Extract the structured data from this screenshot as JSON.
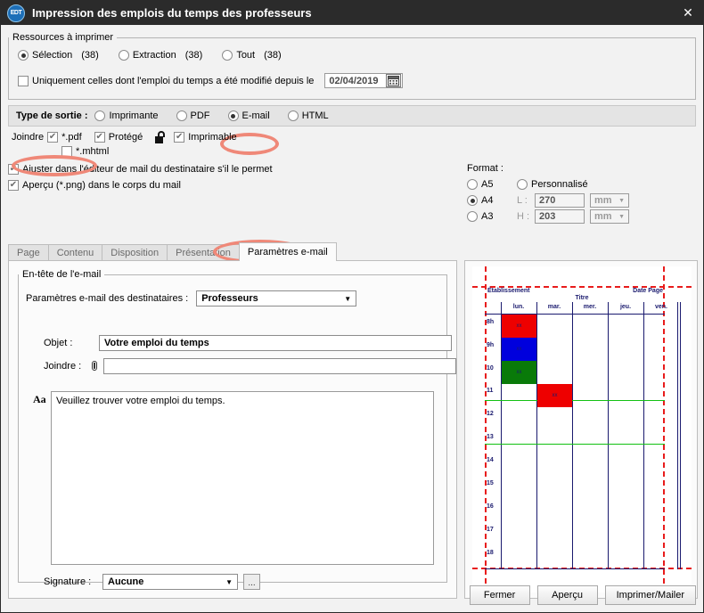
{
  "window": {
    "title": "Impression des emplois du temps des professeurs",
    "logo_text": "EDT",
    "close_icon": "close-icon"
  },
  "resources": {
    "legend": "Ressources à imprimer",
    "options": [
      {
        "label": "Sélection",
        "count": "(38)",
        "selected": true
      },
      {
        "label": "Extraction",
        "count": "(38)",
        "selected": false
      },
      {
        "label": "Tout",
        "count": "(38)",
        "selected": false
      }
    ],
    "modified_checkbox": {
      "label": "Uniquement celles dont l'emploi du temps a été modifié depuis le",
      "checked": false
    },
    "date_value": "02/04/2019",
    "calendar_icon": "calendar-icon"
  },
  "output": {
    "label": "Type de sortie :",
    "options": [
      {
        "label": "Imprimante",
        "selected": false
      },
      {
        "label": "PDF",
        "selected": false
      },
      {
        "label": "E-mail",
        "selected": true
      },
      {
        "label": "HTML",
        "selected": false
      }
    ]
  },
  "attach": {
    "joindre_label": "Joindre",
    "pdf": {
      "label": "*.pdf",
      "checked": true
    },
    "protege": {
      "label": "Protégé",
      "checked": true
    },
    "lock_icon": "unlocked-padlock-icon",
    "imprimable": {
      "label": "Imprimable",
      "checked": true
    },
    "mhtml": {
      "label": "*.mhtml",
      "checked": false
    },
    "ajuster": {
      "label": "Ajuster dans l'éditeur de mail du destinataire s'il le permet",
      "checked": true
    },
    "apercu": {
      "label": "Aperçu (*.png) dans le corps du mail",
      "checked": true
    }
  },
  "format": {
    "title": "Format :",
    "sizes": [
      {
        "label": "A5",
        "selected": false
      },
      {
        "label": "A4",
        "selected": true
      },
      {
        "label": "A3",
        "selected": false
      }
    ],
    "custom": {
      "label": "Personnalisé",
      "selected": false
    },
    "width_label": "L :",
    "width_value": "270",
    "height_label": "H :",
    "height_value": "203",
    "unit": "mm"
  },
  "tabs": [
    {
      "label": "Page",
      "active": false
    },
    {
      "label": "Contenu",
      "active": false
    },
    {
      "label": "Disposition",
      "active": false
    },
    {
      "label": "Présentation",
      "active": false
    },
    {
      "label": "Paramètres e-mail",
      "active": true
    }
  ],
  "email_panel": {
    "legend": "En-tête de l'e-mail",
    "recipients_label": "Paramètres e-mail des destinataires :",
    "recipients_value": "Professeurs",
    "objet_label": "Objet :",
    "objet_value": "Votre emploi du temps",
    "joindre_label": "Joindre :",
    "joindre_value": "",
    "attach_icon": "paperclip-icon",
    "font_button": "Aa",
    "body_text": "Veuillez trouver votre emploi du temps.",
    "signature_label": "Signature :",
    "signature_value": "Aucune",
    "browse_button": "..."
  },
  "preview": {
    "header_left": "Établissement",
    "header_center": "Titre",
    "header_right": "Date Page",
    "days": [
      "lun.",
      "mar.",
      "mer.",
      "jeu.",
      "ven."
    ],
    "hours": [
      "8h",
      "9h",
      "10",
      "11",
      "12",
      "13",
      "14",
      "15",
      "16",
      "17",
      "18"
    ],
    "courses": [
      {
        "day": 0,
        "hour": 0,
        "color": "#ee0000",
        "mark": "xx"
      },
      {
        "day": 0,
        "hour": 1,
        "color": "#0000dd",
        "mark": "xx"
      },
      {
        "day": 0,
        "hour": 2,
        "color": "#097a09",
        "mark": "xx"
      },
      {
        "day": 1,
        "hour": 3,
        "color": "#ee0000",
        "mark": "xx"
      }
    ]
  },
  "footer": {
    "buttons": [
      {
        "label": "Fermer"
      },
      {
        "label": "Aperçu"
      },
      {
        "label": "Imprimer/Mailer"
      }
    ]
  },
  "colors": {
    "annotation": "#ef8878",
    "titlebar": "#2b2b2b",
    "preview_ink": "#1a1a6e",
    "margin_guide": "#e81c1c"
  }
}
